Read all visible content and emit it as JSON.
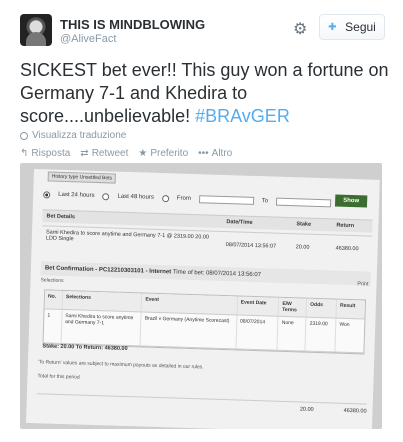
{
  "header": {
    "name": "THIS IS MINDBLOWING",
    "handle": "@AliveFact",
    "follow_label": "Segui"
  },
  "tweet": {
    "text": "SICKEST bet ever!! This guy won a fortune on Germany 7-1 and Khedira to score....unbelievable! ",
    "hashtag": "#BRAvGER"
  },
  "translate_label": "Visualizza traduzione",
  "actions": [
    {
      "icon": "reply-icon",
      "label": "Risposta"
    },
    {
      "icon": "retweet-icon",
      "label": "Retweet"
    },
    {
      "icon": "star-icon",
      "label": "Preferito"
    },
    {
      "icon": "more-icon",
      "label": "Altro"
    }
  ],
  "photo": {
    "history_tab": "History type   Unsettled Bets",
    "radios": {
      "last24": "Last 24 hours",
      "last48": "Last 48 hours",
      "from": "From",
      "to": "To",
      "show": "Show"
    },
    "table_head": {
      "bet_details": "Bet Details",
      "datetime": "Date/Time",
      "stake": "Stake",
      "return": "Return"
    },
    "bet_row": {
      "details": "Sami Khedira to score anytime and Germany 7-1 @ 2319.00 20.00 LDD Single",
      "datetime": "08/07/2014 13:56:07",
      "stake": "20.00",
      "return": "46380.00"
    },
    "confirmation": {
      "label": "Bet Confirmation - PC12210303101 - Internet",
      "time_label": "Time of bet: 08/07/2014 13:56:07"
    },
    "print": "Print",
    "selections_label": "Selections",
    "sel_head": [
      "No.",
      "Selections",
      "Event",
      "Event Date",
      "E/W Terms",
      "Odds",
      "Result"
    ],
    "sel_row": [
      "1",
      "Sami Khedira to score anytime and Germany 7-1",
      "Brazil v Germany (Anytime Scorecast)",
      "08/07/2014",
      "None",
      "2319.00",
      "Won"
    ],
    "stake_line": "Stake: 20.00   To Return: 46380.00",
    "note": "'To Return' values are subject to maximum payouts as detailed in our rules.",
    "total_label": "Total for this period",
    "total_stake": "20.00",
    "total_return": "46380.00"
  }
}
